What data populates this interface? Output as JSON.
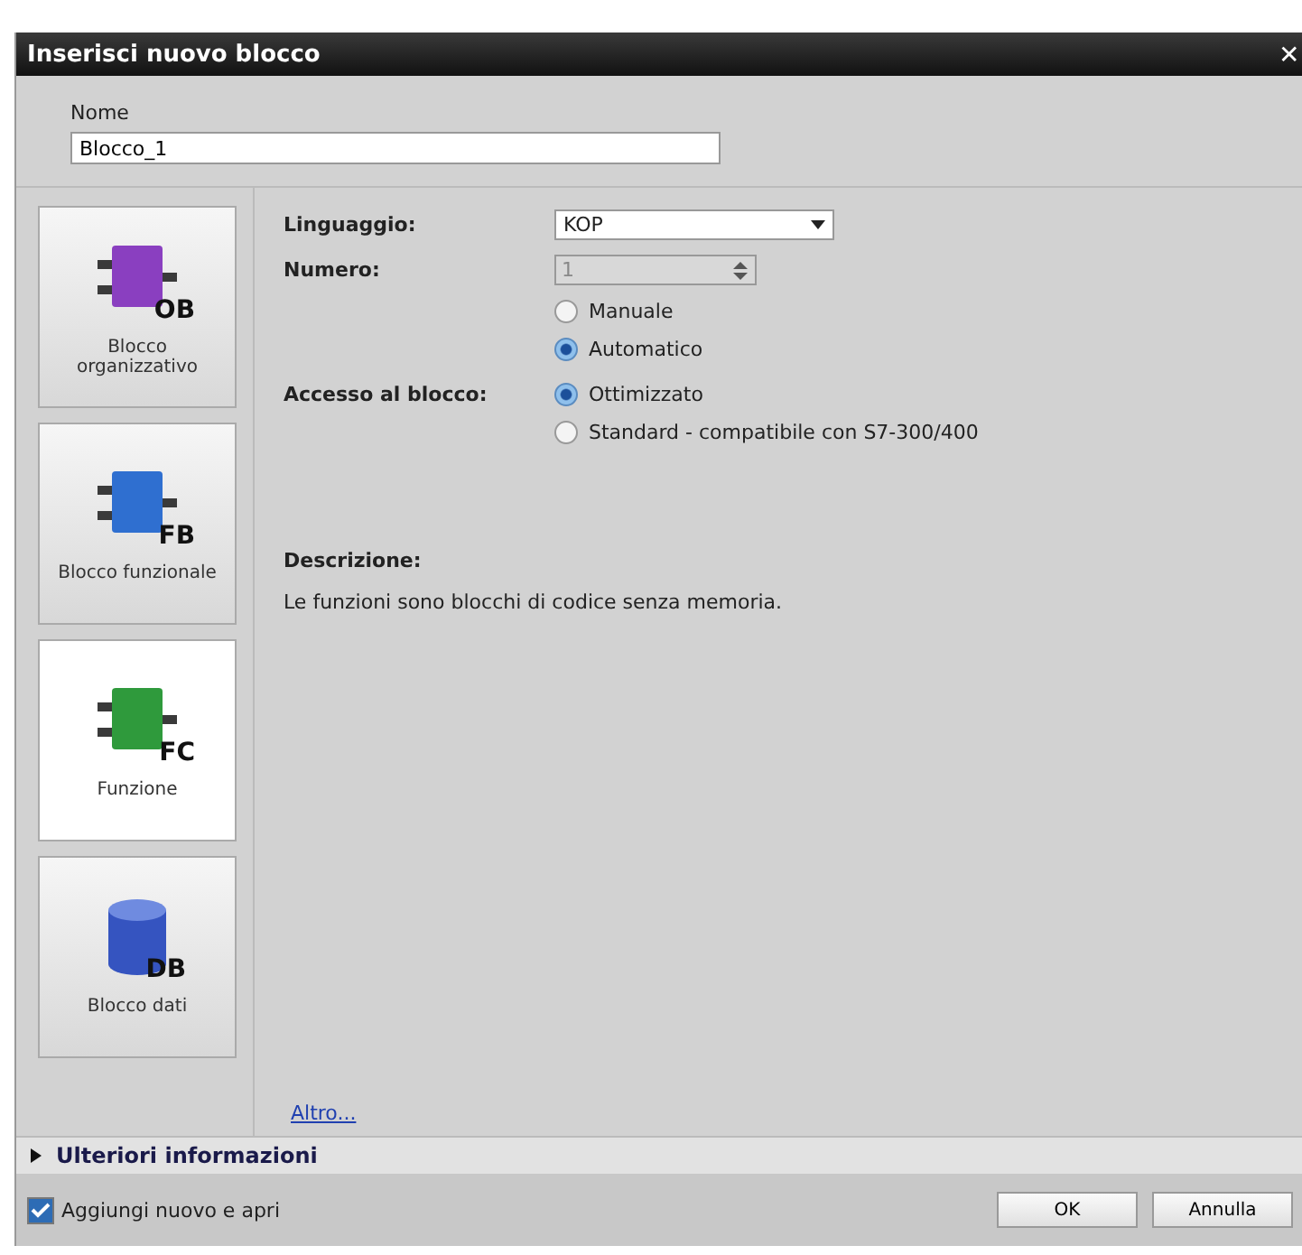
{
  "window": {
    "title": "Inserisci nuovo blocco",
    "close": "✕"
  },
  "name_field": {
    "label": "Nome",
    "value": "Blocco_1"
  },
  "block_types": [
    {
      "kind": "block",
      "badge": "OB",
      "label": "Blocco organizzativo",
      "color": "#8a3fc0",
      "selected": false
    },
    {
      "kind": "block",
      "badge": "FB",
      "label": "Blocco funzionale",
      "color": "#2f6fd0",
      "selected": false
    },
    {
      "kind": "block",
      "badge": "FC",
      "label": "Funzione",
      "color": "#2f9a3c",
      "selected": true
    },
    {
      "kind": "database",
      "badge": "DB",
      "label": "Blocco dati",
      "color": "#3554c0",
      "selected": false
    }
  ],
  "language": {
    "label": "Linguaggio:",
    "value": "KOP"
  },
  "number": {
    "label": "Numero:",
    "value": "1",
    "disabled": true,
    "options": [
      {
        "label": "Manuale",
        "selected": false
      },
      {
        "label": "Automatico",
        "selected": true
      }
    ]
  },
  "access": {
    "label": "Accesso al blocco:",
    "options": [
      {
        "label": "Ottimizzato",
        "selected": true
      },
      {
        "label": "Standard - compatibile con S7-300/400",
        "selected": false
      }
    ]
  },
  "description": {
    "heading": "Descrizione:",
    "text": "Le funzioni sono blocchi di codice senza memoria."
  },
  "more_link": "Altro...",
  "more_info": {
    "label": "Ulteriori informazioni",
    "expanded": false
  },
  "add_and_open": {
    "label": "Aggiungi nuovo e apri",
    "checked": true
  },
  "buttons": [
    "OK",
    "Annulla"
  ]
}
